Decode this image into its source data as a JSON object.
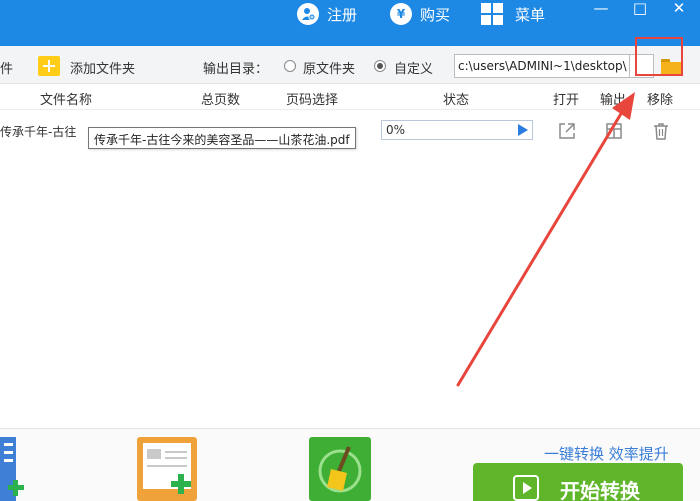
{
  "titlebar": {
    "register_label": "注册",
    "buy_label": "购买",
    "menu_label": "菜单",
    "buy_symbol": "¥",
    "minimize_symbol": "—",
    "maximize_symbol": "□",
    "close_symbol": "✕"
  },
  "toolbar": {
    "add_file_partial": "件",
    "add_folder_label": "添加文件夹",
    "output_dir_label": "输出目录：",
    "option_original": "原文件夹",
    "option_custom": "自定义",
    "selected_option": "自定义",
    "output_path": "c:\\users\\ADMINI~1\\desktop\\"
  },
  "table": {
    "headers": {
      "name": "文件名称",
      "pages": "总页数",
      "page_select": "页码选择",
      "status": "状态",
      "open": "打开",
      "output": "输出",
      "remove": "移除"
    },
    "rows": [
      {
        "name_truncated": "传承千年-古往",
        "tooltip": "传承千年-古往今来的美容圣品——山茶花油.pdf",
        "progress_label": "0%",
        "progress": 0
      }
    ]
  },
  "bottom": {
    "slogan": "一键转换  效率提升",
    "start_label": "开始转换"
  },
  "colors": {
    "brand_blue": "#1e88e5",
    "start_green": "#5fb62b",
    "highlight_red": "#e8453c",
    "folder_yellow": "#f5b21b"
  },
  "icons": [
    "user-plus-icon",
    "yuan-icon",
    "windows-grid-icon",
    "add-icon",
    "folder-icon",
    "open-external-icon",
    "output-icon",
    "trash-icon",
    "add-document-icon",
    "clean-broom-icon",
    "play-icon"
  ]
}
